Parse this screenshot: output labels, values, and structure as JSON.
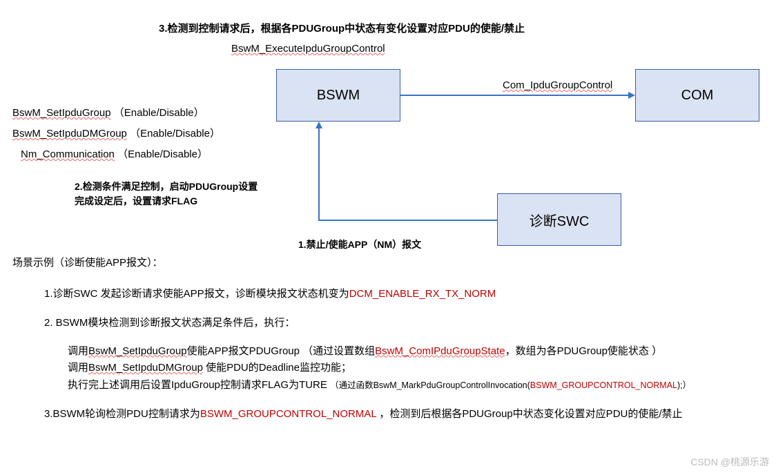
{
  "diagram": {
    "step3_label": "3.检测到控制请求后，根据各PDUGroup中状态有变化设置对应PDU的使能/禁止",
    "step3_fn": "BswM_ExecuteIpduGroupControl",
    "step2_line1": "2.检测条件满足控制，启动PDUGroup设置",
    "step2_line2": "完成设定后，设置请求FLAG",
    "step1_label": "1.禁止/使能APP（NM）报文",
    "fn1_name": "BswM_SetIpduGroup",
    "fn1_arg": "（Enable/Disable）",
    "fn2_name": "BswM_SetIpduDMGroup",
    "fn2_arg": "（Enable/Disable）",
    "fn3_name": "Nm_Communication",
    "fn3_arg": "（Enable/Disable）",
    "arrow_fn": "Com_IpduGroupControl",
    "node_bswm": "BSWM",
    "node_com": "COM",
    "node_swc": "诊断SWC"
  },
  "scenario": {
    "title": "场景示例（诊断使能APP报文）：",
    "item1_pre": "1.诊断SWC 发起诊断请求使能APP报文，诊断模块报文状态机变为",
    "item1_red": "DCM_ENABLE_RX_TX_NORM",
    "item2_header": "2. BSWM模块检测到诊断报文状态满足条件后，执行：",
    "item2a_pre": "调用",
    "item2a_fn": "BswM_SetIpduGroup",
    "item2a_mid": "使能APP报文PDUGroup （通过设置数组",
    "item2a_red": "BswM_ComIPduGroupState",
    "item2a_post": "，数组为各PDUGroup使能状态 ）",
    "item2b_pre": "调用",
    "item2b_fn": "BswM_SetIpduDMGroup",
    "item2b_post": " 使能PDU的Deadline监控功能；",
    "item2c_pre": "执行完上述调用后设置IpduGroup控制请求FLAG为TURE ",
    "item2c_paren_pre": "（通过函数BswM_MarkPduGroupControlInvocation(",
    "item2c_paren_red": "BSWM_GROUPCONTROL_NORMAL",
    "item2c_paren_post": ");）",
    "item3_pre": "3.BSWM轮询检测PDU控制请求为",
    "item3_red": "BSWM_GROUPCONTROL_NORMAL",
    "item3_post": " ，检测到后根据各PDUGroup中状态变化设置对应PDU的使能/禁止"
  },
  "watermark": "CSDN @桃源乐游"
}
